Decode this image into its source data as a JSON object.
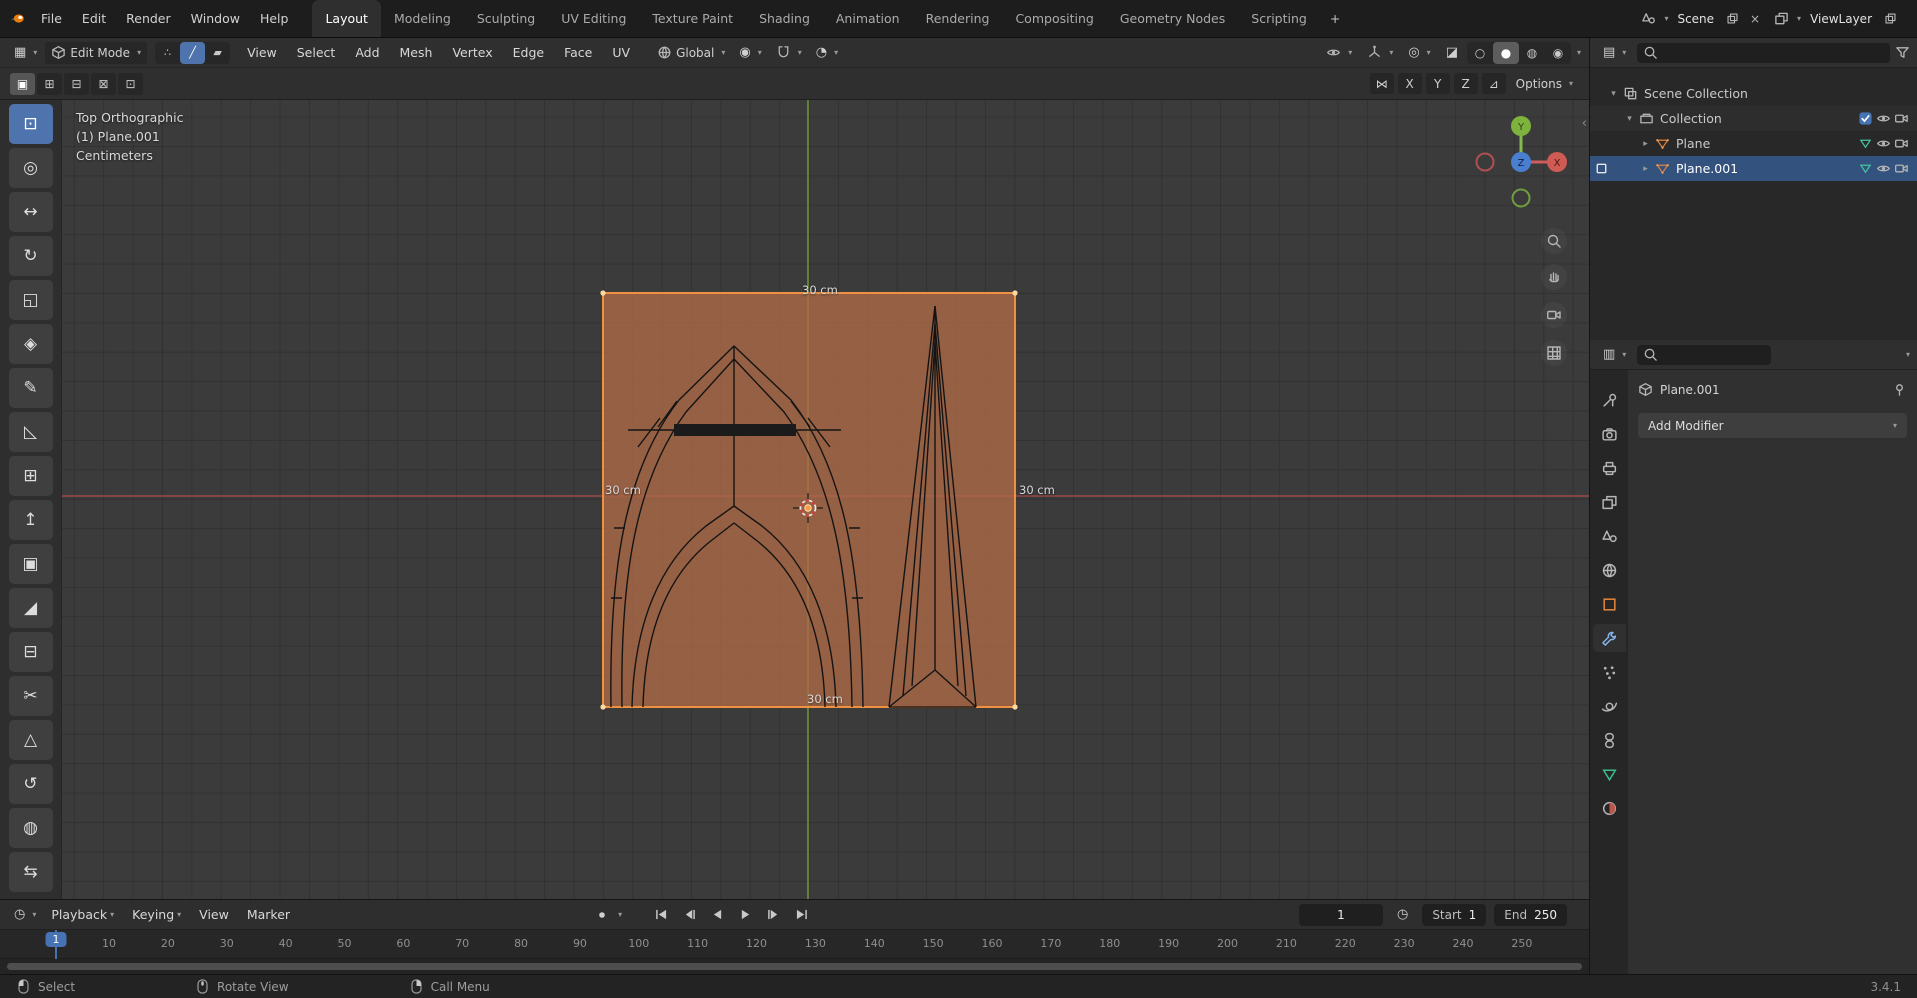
{
  "colors": {
    "accent": "#4772b3",
    "selection_orange": "#ef9240",
    "axis_x": "#d05a54",
    "axis_y": "#7db33c",
    "axis_z": "#4a7fd0",
    "viewport_bg": "#3b3b3b"
  },
  "topbar": {
    "menus": [
      "File",
      "Edit",
      "Render",
      "Window",
      "Help"
    ],
    "workspaces": [
      "Layout",
      "Modeling",
      "Sculpting",
      "UV Editing",
      "Texture Paint",
      "Shading",
      "Animation",
      "Rendering",
      "Compositing",
      "Geometry Nodes",
      "Scripting"
    ],
    "active_workspace": "Layout",
    "new_workspace": "+",
    "scene_label": "Scene",
    "viewlayer_label": "ViewLayer"
  },
  "viewport_header": {
    "mode": "Edit Mode",
    "menus": [
      "View",
      "Select",
      "Add",
      "Mesh",
      "Vertex",
      "Edge",
      "Face",
      "UV"
    ],
    "orientation": "Global",
    "mirror_axes": [
      "X",
      "Y",
      "Z"
    ],
    "options": "Options"
  },
  "tools": [
    {
      "name": "select-box-tool",
      "glyph": "⊡",
      "active": true
    },
    {
      "name": "cursor-tool",
      "glyph": "◎"
    },
    {
      "name": "move-tool",
      "glyph": "↔"
    },
    {
      "name": "rotate-tool",
      "glyph": "↻"
    },
    {
      "name": "scale-tool",
      "glyph": "◱"
    },
    {
      "name": "transform-tool",
      "glyph": "◈"
    },
    {
      "name": "annotate-tool",
      "glyph": "✎"
    },
    {
      "name": "measure-tool",
      "glyph": "◺"
    },
    {
      "name": "add-cube-tool",
      "glyph": "⊞"
    },
    {
      "name": "extrude-region-tool",
      "glyph": "↥"
    },
    {
      "name": "inset-faces-tool",
      "glyph": "▣"
    },
    {
      "name": "bevel-tool",
      "glyph": "◢"
    },
    {
      "name": "loop-cut-tool",
      "glyph": "⊟"
    },
    {
      "name": "knife-tool",
      "glyph": "✂"
    },
    {
      "name": "poly-build-tool",
      "glyph": "△"
    },
    {
      "name": "spin-tool",
      "glyph": "↺"
    },
    {
      "name": "smooth-tool",
      "glyph": "◍"
    },
    {
      "name": "edge-slide-tool",
      "glyph": "⇆"
    }
  ],
  "viewport": {
    "view_label": "Top Orthographic",
    "object_label": "(1) Plane.001",
    "unit_label": "Centimeters",
    "dim_top": "30 cm",
    "dim_left": "30 cm",
    "dim_right": "30 cm",
    "dim_bottom": "30 cm",
    "axis_x": "X",
    "axis_y": "Y",
    "axis_z": "Z"
  },
  "outliner": {
    "rows": [
      {
        "label": "Scene Collection",
        "depth": 0,
        "arrow": "▾",
        "icon": "scenecol"
      },
      {
        "label": "Collection",
        "depth": 1,
        "arrow": "▾",
        "icon": "collection",
        "checkbox": true,
        "eye": true,
        "camera": true
      },
      {
        "label": "Plane",
        "depth": 2,
        "arrow": "▸",
        "icon": "mesh",
        "badge": true,
        "eye": true,
        "camera": true
      },
      {
        "label": "Plane.001",
        "depth": 2,
        "arrow": "▸",
        "icon": "mesh",
        "badge": true,
        "eye": true,
        "camera": true,
        "selected": true,
        "edit": true
      }
    ]
  },
  "properties": {
    "tabs": [
      {
        "name": "tool-tab",
        "icon": "tool"
      },
      {
        "name": "render-tab",
        "icon": "render"
      },
      {
        "name": "output-tab",
        "icon": "output"
      },
      {
        "name": "view-layer-tab",
        "icon": "viewlayer"
      },
      {
        "name": "scene-tab",
        "icon": "scene"
      },
      {
        "name": "world-tab",
        "icon": "world"
      },
      {
        "name": "object-tab",
        "icon": "object"
      },
      {
        "name": "modifiers-tab",
        "icon": "modifier",
        "active": true
      },
      {
        "name": "particles-tab",
        "icon": "particles"
      },
      {
        "name": "physics-tab",
        "icon": "physics"
      },
      {
        "name": "constraints-tab",
        "icon": "constraints"
      },
      {
        "name": "object-data-tab",
        "icon": "data"
      },
      {
        "name": "material-tab",
        "icon": "material"
      }
    ],
    "breadcrumb": "Plane.001",
    "add_modifier": "Add Modifier"
  },
  "timeline": {
    "menus": [
      "Playback",
      "Keying",
      "View",
      "Marker"
    ],
    "current_frame": "1",
    "start_label": "Start",
    "start_value": "1",
    "end_label": "End",
    "end_value": "250",
    "frames": [
      1,
      10,
      20,
      30,
      40,
      50,
      60,
      70,
      80,
      90,
      100,
      110,
      120,
      130,
      140,
      150,
      160,
      170,
      180,
      190,
      200,
      210,
      220,
      230,
      240,
      250
    ]
  },
  "statusbar": {
    "items": [
      "Select",
      "Rotate View",
      "Call Menu"
    ],
    "version": "3.4.1"
  }
}
